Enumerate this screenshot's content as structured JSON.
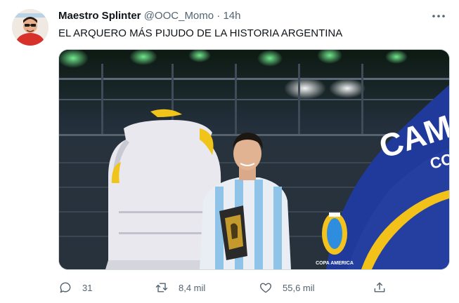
{
  "tweet": {
    "author_name": "Maestro Splinter",
    "handle": "@OOC_Momo",
    "separator": "·",
    "time": "14h",
    "text": "EL ARQUERO MÁS PIJUDO DE LA HISTORIA ARGENTINA",
    "media": {
      "banner_text_line1": "CAM",
      "banner_text_line2": "CO",
      "trophy_base_text": "COPA AMERICA"
    },
    "actions": {
      "reply_count": "31",
      "retweet_count": "8,4 mil",
      "like_count": "55,6 mil"
    }
  },
  "icons": {
    "more": "more-dots-icon",
    "reply": "reply-icon",
    "retweet": "retweet-icon",
    "like": "heart-icon",
    "share": "share-icon"
  },
  "colors": {
    "text_primary": "#0f1419",
    "text_secondary": "#536471",
    "banner_blue": "#1f3a9a"
  }
}
